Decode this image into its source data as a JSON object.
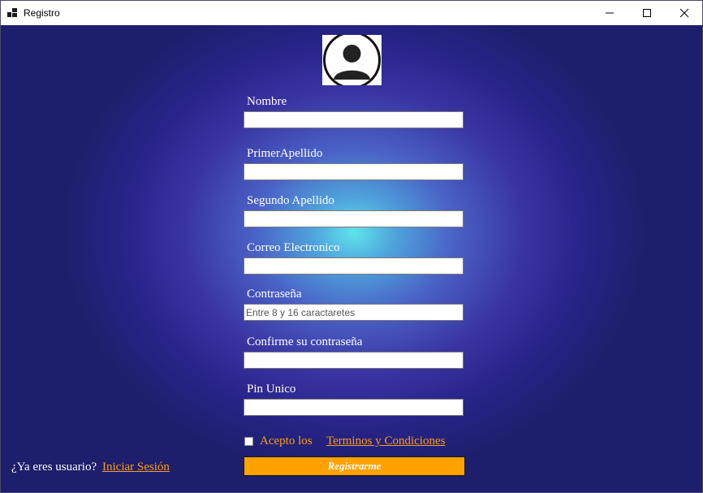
{
  "window": {
    "title": "Registro"
  },
  "form": {
    "nombre_label": "Nombre",
    "nombre_value": "",
    "primer_apellido_label": "PrimerApellido",
    "primer_apellido_value": "",
    "segundo_apellido_label": "Segundo Apellido",
    "segundo_apellido_value": "",
    "correo_label": "Correo Electronico",
    "correo_value": "",
    "contrasena_label": "Contraseña",
    "contrasena_placeholder": "Entre 8 y 16 caractaretes",
    "confirme_label": "Confirme su contraseña",
    "confirme_value": "",
    "pin_label": "Pin Unico",
    "pin_value": ""
  },
  "terms": {
    "checked": false,
    "accept_text": "Acepto los",
    "link_text": "Terminos y Condiciones"
  },
  "actions": {
    "register_label": "Registrarme"
  },
  "login": {
    "question": "¿Ya eres usuario?",
    "link_text": "Iniciar Sesión"
  },
  "colors": {
    "accent_orange": "#ffa200",
    "link_orange": "#ff9c1a",
    "background_center": "#5fe3ec",
    "background_edge": "#1d1f6c"
  }
}
